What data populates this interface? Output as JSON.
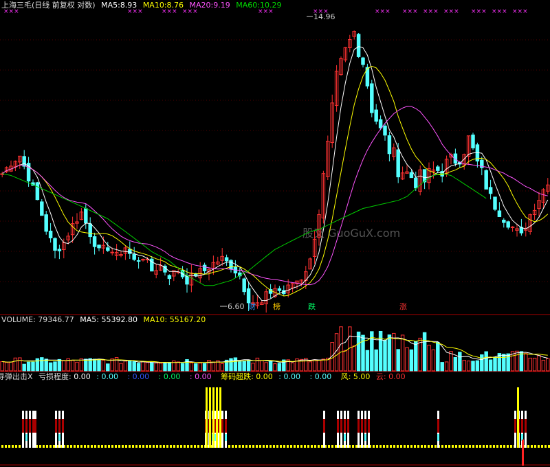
{
  "price_panel": {
    "stock_name": "上海三毛",
    "period_label": "(日线 前复权 对数)",
    "ma5_label": "MA5:",
    "ma5_value": "8.93",
    "ma10_label": "MA10:",
    "ma10_value": "8.76",
    "ma20_label": "MA20:",
    "ma20_value": "9.19",
    "ma60_label": "MA60:",
    "ma60_value": "10.29",
    "high_label": "14.96",
    "low_label": "6.60",
    "event_tags": [
      "财",
      "榜",
      "跌",
      "涨"
    ],
    "x_markers": "×××",
    "watermark": "股叉 GuoGuX.com",
    "colors": {
      "ma5": "#ffffff",
      "ma10": "#ffff00",
      "ma20": "#ff55ff",
      "ma60": "#00cc00",
      "up": "#ff3232",
      "down": "#54ffff"
    }
  },
  "volume_panel": {
    "volume_label": "VOLUME:",
    "volume_value": "79346.77",
    "ma5_label": "MA5:",
    "ma5_value": "55392.80",
    "ma10_label": "MA10:",
    "ma10_value": "55167.20"
  },
  "indicator_panel": {
    "name": "寻弹出击X",
    "loss_label": "亏损程度:",
    "loss_value": "0.00",
    "v2": "0.00",
    "v3": "0.00",
    "v4": "0.00",
    "v5": "0.00",
    "chip_label": "筹码超跌:",
    "chip_value": "0.00",
    "v7": "0.00",
    "v8": "0.00",
    "wind_label": "风:",
    "wind_value": "5.00",
    "cloud_label": "云:",
    "cloud_value": "0.00"
  },
  "chart_data": {
    "type": "candlestick",
    "title": "上海三毛(日线 前复权 对数)",
    "y_high": 14.96,
    "y_low": 6.6,
    "price": [
      9.6,
      9.9,
      10.1,
      9.5,
      8.9,
      8.2,
      7.7,
      7.9,
      8.3,
      8.6,
      8.1,
      7.7,
      7.8,
      7.6,
      7.8,
      7.5,
      7.6,
      7.3,
      7.4,
      7.2,
      7.3,
      7.1,
      7.25,
      7.3,
      7.45,
      7.55,
      7.4,
      7.2,
      6.7,
      6.3,
      6.8,
      6.95,
      6.85,
      7.05,
      7.15,
      7.5,
      8.6,
      10.3,
      12.5,
      13.5,
      14.3,
      13.2,
      11.6,
      10.8,
      10.3,
      9.8,
      9.6,
      9.45,
      9.4,
      9.65,
      9.75,
      9.9,
      10.15,
      10.55,
      9.85,
      9.25,
      8.75,
      8.45,
      8.25,
      8.05,
      8.55,
      8.95,
      9.4
    ],
    "ma60": [
      9.6,
      9.55,
      9.45,
      9.35,
      9.25,
      9.15,
      9.05,
      8.95,
      8.85,
      8.75,
      8.65,
      8.55,
      8.45,
      8.3,
      8.15,
      8.0,
      7.85,
      7.7,
      7.6,
      7.5,
      7.35,
      7.2,
      7.1,
      7.0,
      7.0,
      7.05,
      7.1,
      7.2,
      7.3,
      7.45,
      7.6,
      7.75,
      7.85,
      7.95,
      8.05,
      8.15,
      8.2,
      8.3,
      8.4,
      8.5,
      8.6,
      8.7,
      8.75,
      8.8,
      8.85,
      8.9,
      9.0,
      9.2,
      9.4,
      9.55,
      9.6,
      9.55,
      9.4,
      9.25,
      9.1,
      8.95
    ]
  }
}
